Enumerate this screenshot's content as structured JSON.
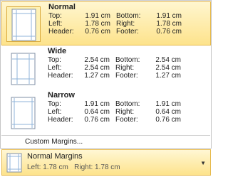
{
  "gallery": {
    "items": [
      {
        "title": "Normal",
        "labels1": [
          "Top:",
          "Left:",
          "Header:"
        ],
        "values1": [
          "1.91 cm",
          "1.78 cm",
          "0.76 cm"
        ],
        "labels2": [
          "Bottom:",
          "Right:",
          "Footer:"
        ],
        "values2": [
          "1.91 cm",
          "1.78 cm",
          "0.76 cm"
        ],
        "icon": "normal-margins-icon"
      },
      {
        "title": "Wide",
        "labels1": [
          "Top:",
          "Left:",
          "Header:"
        ],
        "values1": [
          "2.54 cm",
          "2.54 cm",
          "1.27 cm"
        ],
        "labels2": [
          "Bottom:",
          "Right:",
          "Footer:"
        ],
        "values2": [
          "2.54 cm",
          "2.54 cm",
          "1.27 cm"
        ],
        "icon": "wide-margins-icon"
      },
      {
        "title": "Narrow",
        "labels1": [
          "Top:",
          "Left:",
          "Header:"
        ],
        "values1": [
          "1.91 cm",
          "0.64 cm",
          "0.76 cm"
        ],
        "labels2": [
          "Bottom:",
          "Right:",
          "Footer:"
        ],
        "values2": [
          "1.91 cm",
          "0.64 cm",
          "0.76 cm"
        ],
        "icon": "narrow-margins-icon"
      }
    ],
    "custom_label": "Custom Margins..."
  },
  "dropdown": {
    "title": "Normal Margins",
    "detail": "Left: 1.78 cm   Right: 1.78 cm",
    "arrow": "▼",
    "icon": "page-margins-icon"
  },
  "colors": {
    "selection_top": "#fff6cf",
    "selection_bottom": "#fde38c",
    "selection_border": "#e6b94c",
    "page_outline": "#7f8fa4"
  }
}
